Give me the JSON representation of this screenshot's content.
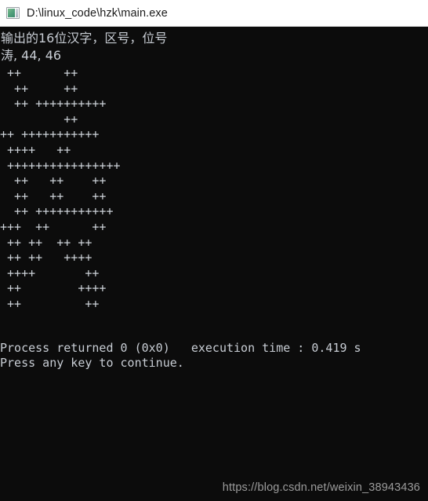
{
  "window": {
    "title": "D:\\linux_code\\hzk\\main.exe",
    "icon": "console-window-icon",
    "background_color": "#0c0c0c",
    "text_color": "#c8cdd4",
    "titlebar_color": "#ffffff"
  },
  "console": {
    "header_lines": [
      "输出的16位汉字，区号，位号",
      "涛, 44, 46"
    ],
    "art_lines": [
      " ++      ++",
      "  ++     ++",
      "  ++ ++++++++++",
      "         ++",
      "++ +++++++++++",
      " ++++   ++",
      " ++++++++++++++++",
      "  ++   ++    ++",
      "  ++   ++    ++",
      "  ++ +++++++++++",
      "+++  ++      ++",
      " ++ ++  ++ ++",
      " ++ ++   ++++",
      " ++++       ++",
      " ++        ++++",
      " ++         ++"
    ],
    "tail_lines": [
      "Process returned 0 (0x0)   execution time : 0.419 s",
      "Press any key to continue."
    ]
  },
  "watermark": {
    "text": "https://blog.csdn.net/weixin_38943436"
  }
}
